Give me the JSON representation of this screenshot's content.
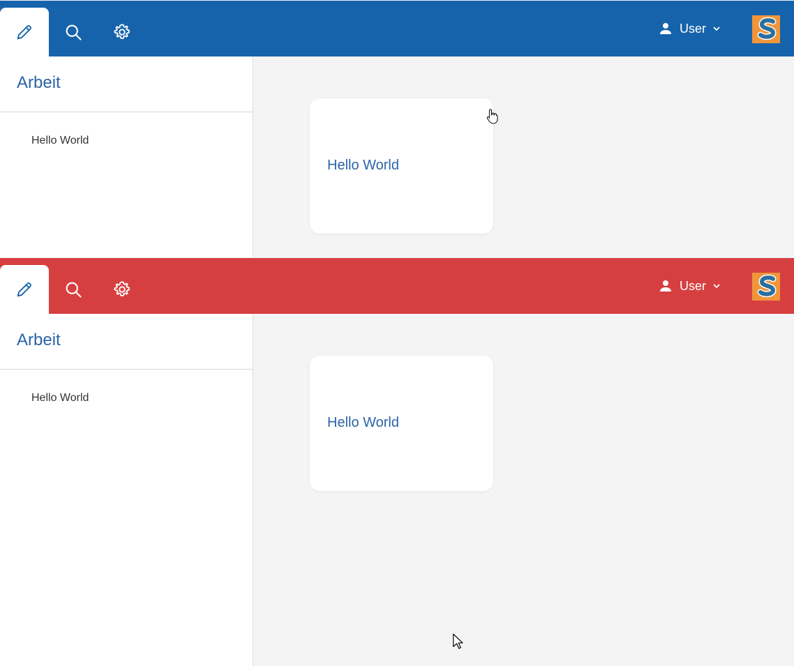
{
  "instances": [
    {
      "theme": {
        "header_color": "#1763ab",
        "accent": "#2a64a8"
      },
      "header": {
        "tabs": [
          {
            "name": "pencil-icon",
            "active": true
          },
          {
            "name": "search-icon",
            "active": false
          },
          {
            "name": "gear-icon",
            "active": false
          }
        ],
        "user_label": "User"
      },
      "sidebar": {
        "title": "Arbeit",
        "items": [
          {
            "label": "Hello World"
          }
        ]
      },
      "main": {
        "card": {
          "label": "Hello World"
        }
      }
    },
    {
      "theme": {
        "header_color": "#d63f40",
        "accent": "#2a64a8"
      },
      "header": {
        "tabs": [
          {
            "name": "pencil-icon",
            "active": true
          },
          {
            "name": "search-icon",
            "active": false
          },
          {
            "name": "gear-icon",
            "active": false
          }
        ],
        "user_label": "User"
      },
      "sidebar": {
        "title": "Arbeit",
        "items": [
          {
            "label": "Hello World"
          }
        ]
      },
      "main": {
        "card": {
          "label": "Hello World"
        }
      }
    }
  ]
}
